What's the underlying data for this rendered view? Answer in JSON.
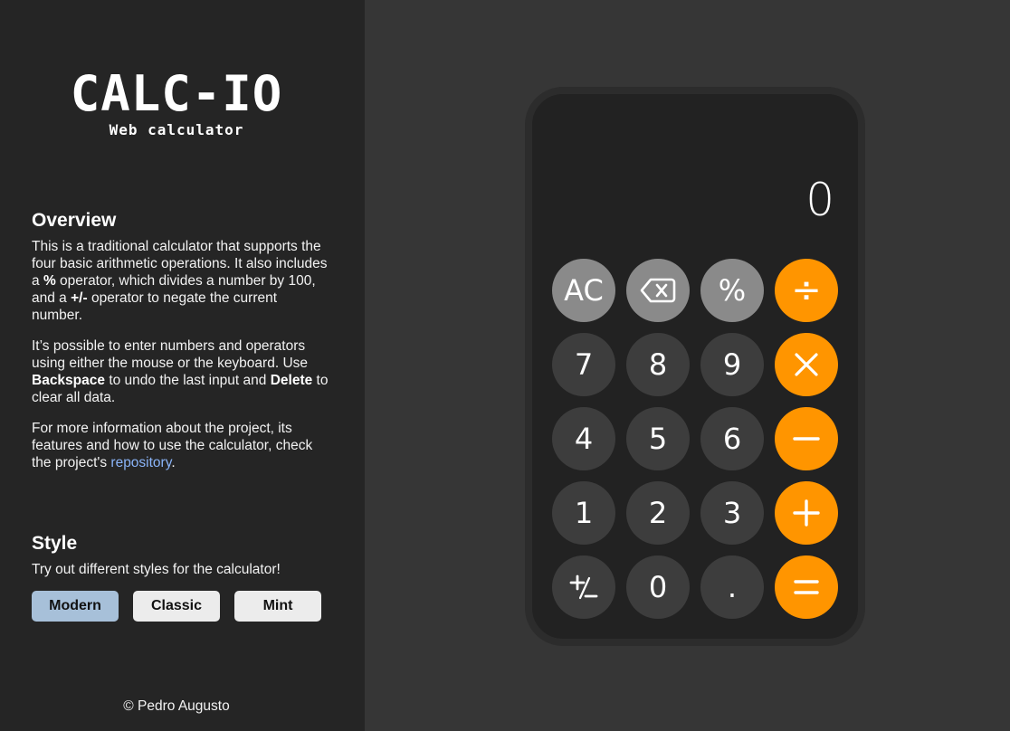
{
  "logo": {
    "title": "CALC-IO",
    "subtitle": "Web calculator"
  },
  "overview": {
    "heading": "Overview",
    "p1": {
      "t1": "This is a traditional calculator that supports the four basic arithmetic operations. It also includes a ",
      "b1": "%",
      "t2": " operator, which divides a number by 100, and a ",
      "b2": "+/-",
      "t3": " operator to negate the current number."
    },
    "p2": {
      "t1": "It’s possible to enter numbers and operators using either the mouse or the keyboard. Use ",
      "b1": "Backspace",
      "t2": " to undo the last input and ",
      "b2": "Delete",
      "t3": " to clear all data."
    },
    "p3": {
      "t1": "For more information about the project, its features and how to use the calculator, check the project's ",
      "link": "repository",
      "t2": "."
    }
  },
  "style": {
    "heading": "Style",
    "description": "Try out different styles for the calculator!",
    "buttons": [
      "Modern",
      "Classic",
      "Mint"
    ],
    "active": "Modern"
  },
  "footer": "© Pedro Augusto",
  "calculator": {
    "display": "0",
    "keys": {
      "ac": "AC",
      "percent": "%",
      "seven": "7",
      "eight": "8",
      "nine": "9",
      "four": "4",
      "five": "5",
      "six": "6",
      "one": "1",
      "two": "2",
      "three": "3",
      "zero": "0",
      "dot": ".",
      "divide": "÷"
    },
    "icons": [
      "backspace-icon",
      "multiply-icon",
      "minus-icon",
      "plus-icon",
      "equals-icon",
      "plus-minus-icon"
    ],
    "colors": {
      "function": "#8a8a8a",
      "number": "#3d3d3d",
      "operator": "#ff9500"
    }
  }
}
